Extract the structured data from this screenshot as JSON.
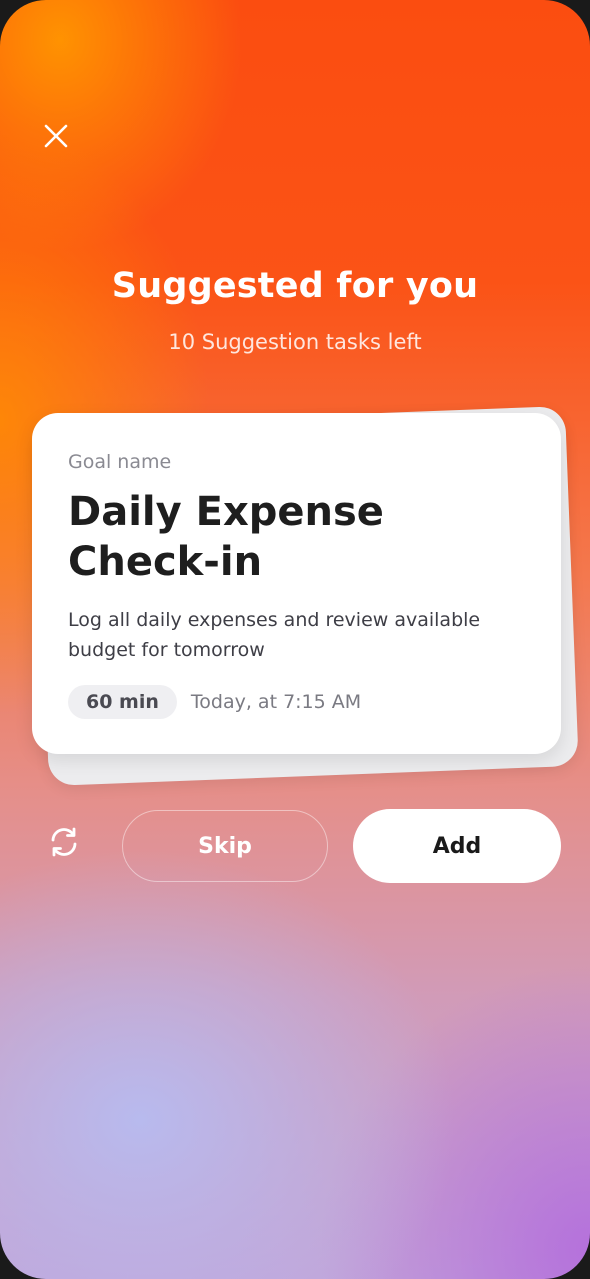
{
  "header": {
    "close_icon": "close-icon",
    "title": "Suggested for you",
    "subtitle": "10 Suggestion tasks left"
  },
  "card": {
    "label": "Goal name",
    "title": "Daily Expense Check-in",
    "description": "Log all daily expenses and review available budget for tomorrow",
    "duration": "60 min",
    "schedule": "Today, at 7:15 AM"
  },
  "actions": {
    "refresh_icon": "refresh-icon",
    "skip_label": "Skip",
    "add_label": "Add"
  },
  "colors": {
    "background_top": "#fb4d10",
    "background_bottom": "#c2a4d8",
    "card_bg": "#ffffff",
    "text_dark": "#1e1e1e"
  }
}
